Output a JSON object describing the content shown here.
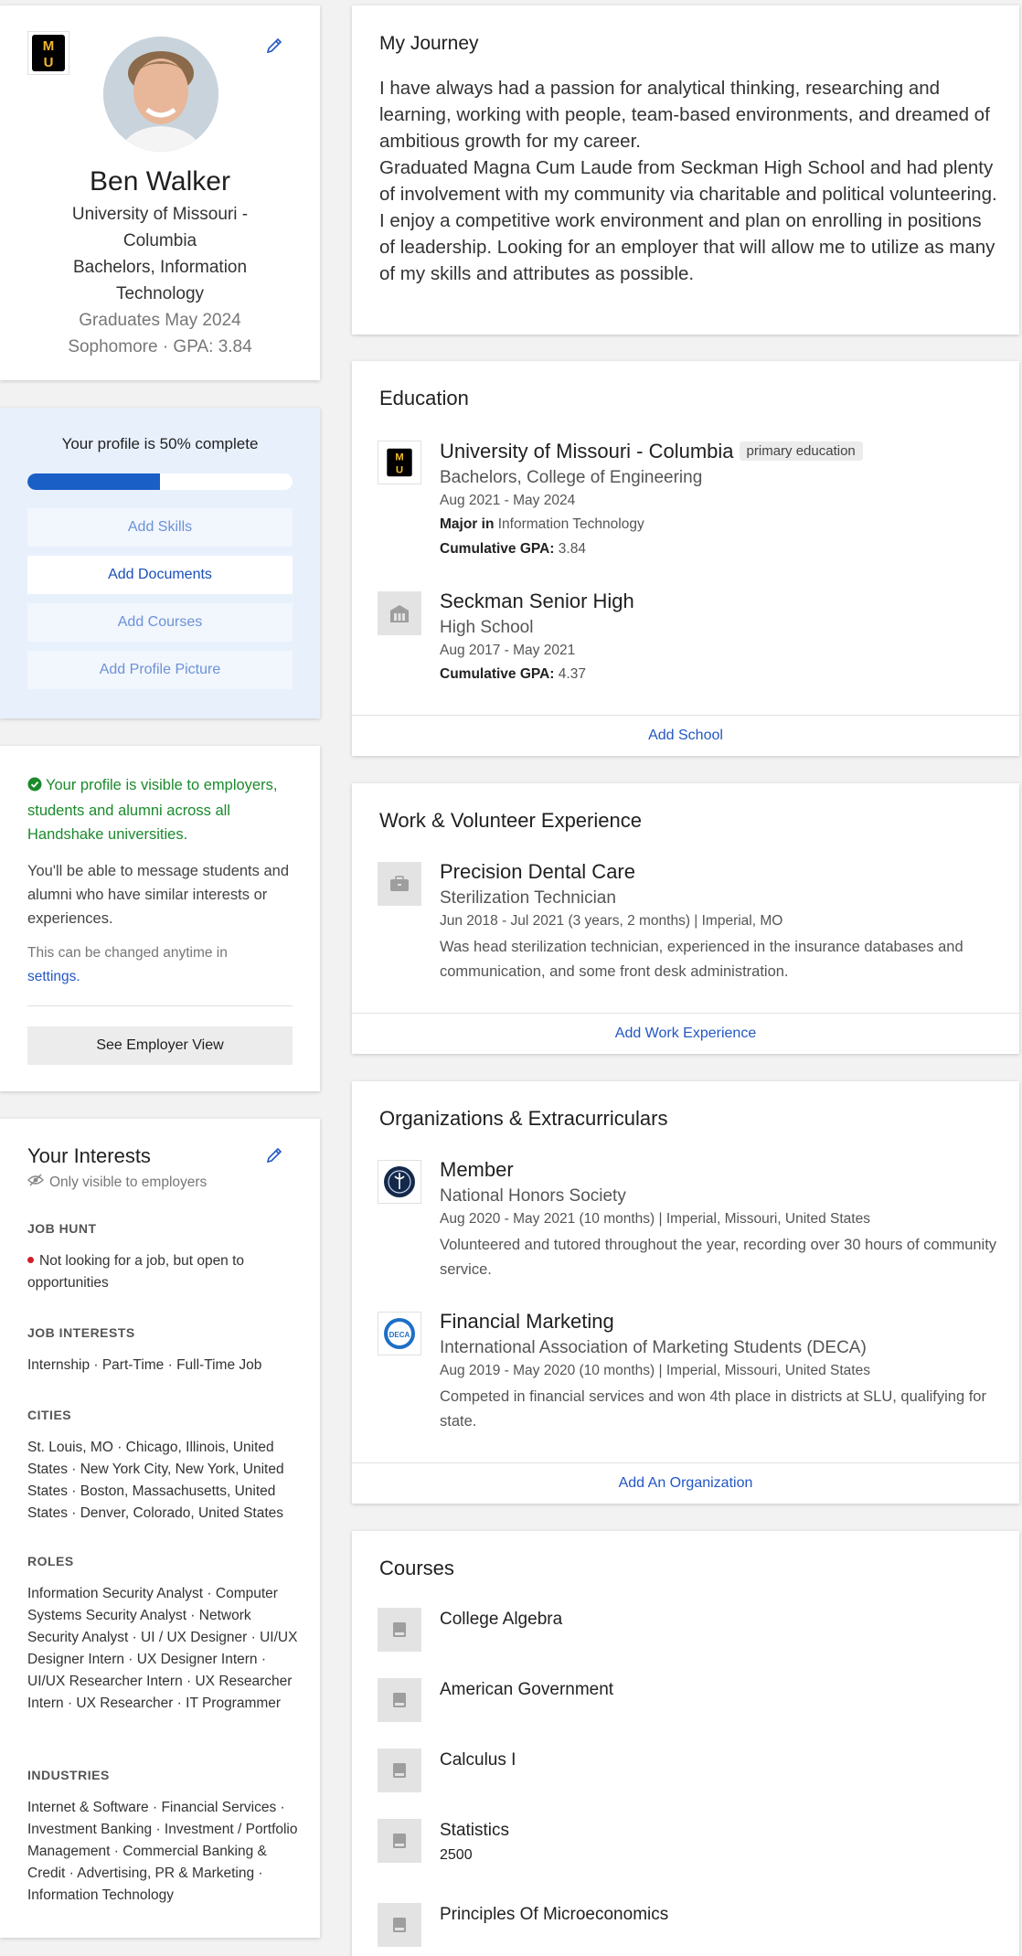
{
  "profile": {
    "name": "Ben Walker",
    "school_line1": "University of Missouri -",
    "school_line2": "Columbia",
    "degree_line1": "Bachelors, Information",
    "degree_line2": "Technology",
    "graduates": "Graduates May 2024",
    "year_gpa": "Sophomore · GPA: 3.84",
    "school_logo_text": "MU"
  },
  "completion": {
    "title": "Your profile is 50% complete",
    "percent": 50,
    "buttons": [
      "Add Skills",
      "Add Documents",
      "Add Courses",
      "Add Profile Picture"
    ]
  },
  "visibility": {
    "notice": "Your profile is visible to employers, students and alumni across all Handshake universities.",
    "message": "You'll be able to message students and alumni who have similar interests or experiences.",
    "changeable": "This can be changed anytime in",
    "settings_link": "settings.",
    "employer_view_button": "See Employer View"
  },
  "interests": {
    "title": "Your Interests",
    "subtitle": "Only visible to employers",
    "job_hunt_heading": "JOB HUNT",
    "job_hunt": "Not looking for a job, but open to opportunities",
    "job_interests_heading": "JOB INTERESTS",
    "job_interests": "Internship · Part-Time · Full-Time Job",
    "cities_heading": "CITIES",
    "cities": "St. Louis, MO · Chicago, Illinois, United States · New York City, New York, United States · Boston, Massachusetts, United States · Denver, Colorado, United States",
    "roles_heading": "ROLES",
    "roles": "Information Security Analyst · Computer Systems Security Analyst · Network Security Analyst · UI / UX Designer · UI/UX Designer Intern · UX Designer Intern · UI/UX Researcher Intern · UX Researcher Intern · UX Researcher · IT Programmer",
    "industries_heading": "INDUSTRIES",
    "industries": "Internet & Software · Financial Services · Investment Banking · Investment / Portfolio Management · Commercial Banking & Credit · Advertising, PR & Marketing · Information Technology"
  },
  "journey": {
    "title": "My Journey",
    "p1": "I have always had a passion for analytical thinking, researching and learning, working with people, team-based environments, and dreamed of ambitious growth for my career.",
    "p2": "Graduated Magna Cum Laude from Seckman High School and had plenty of involvement with my community via charitable and political volunteering.",
    "p3": "I enjoy a competitive work environment and plan on enrolling in positions of leadership. Looking for an employer that will allow me to utilize as many of my skills and attributes as possible."
  },
  "education": {
    "title": "Education",
    "entries": [
      {
        "school": "University of Missouri - Columbia",
        "badge": "primary education",
        "degree": "Bachelors, College of Engineering",
        "dates": "Aug 2021 - May 2024",
        "major_label": "Major in",
        "major": "Information Technology",
        "gpa_label": "Cumulative GPA:",
        "gpa": "3.84"
      },
      {
        "school": "Seckman Senior High",
        "degree": "High School",
        "dates": "Aug 2017 - May 2021",
        "gpa_label": "Cumulative GPA:",
        "gpa": "4.37"
      }
    ],
    "add_label": "Add School"
  },
  "work": {
    "title": "Work & Volunteer Experience",
    "entries": [
      {
        "employer": "Precision Dental Care",
        "role": "Sterilization Technician",
        "meta": "Jun 2018 - Jul 2021 (3 years, 2 months)  |  Imperial, MO",
        "description": "Was head sterilization technician, experienced in the insurance databases and communication, and some front desk administration."
      }
    ],
    "add_label": "Add Work Experience"
  },
  "organizations": {
    "title": "Organizations & Extracurriculars",
    "entries": [
      {
        "role": "Member",
        "org": "National Honors Society",
        "meta": "Aug 2020 - May 2021 (10 months)  |  Imperial, Missouri, United States",
        "description": "Volunteered and tutored throughout the year, recording over 30 hours of community service."
      },
      {
        "role": "Financial Marketing",
        "org": "International Association of Marketing Students (DECA)",
        "meta": "Aug 2019 - May 2020 (10 months)  |  Imperial, Missouri, United States",
        "description": "Competed in financial services and won 4th place in districts at SLU, qualifying for state.",
        "logo_text": "DECA"
      }
    ],
    "add_label": "Add An Organization"
  },
  "courses": {
    "title": "Courses",
    "items": [
      {
        "name": "College Algebra"
      },
      {
        "name": "American Government"
      },
      {
        "name": "Calculus I"
      },
      {
        "name": "Statistics",
        "number": "2500"
      },
      {
        "name": "Principles Of Microeconomics"
      }
    ]
  },
  "colors": {
    "accent": "#2257c3",
    "progress": "#1a5fc6",
    "visible_green": "#1b8a2c",
    "mizzou_gold": "#f1b82d"
  }
}
